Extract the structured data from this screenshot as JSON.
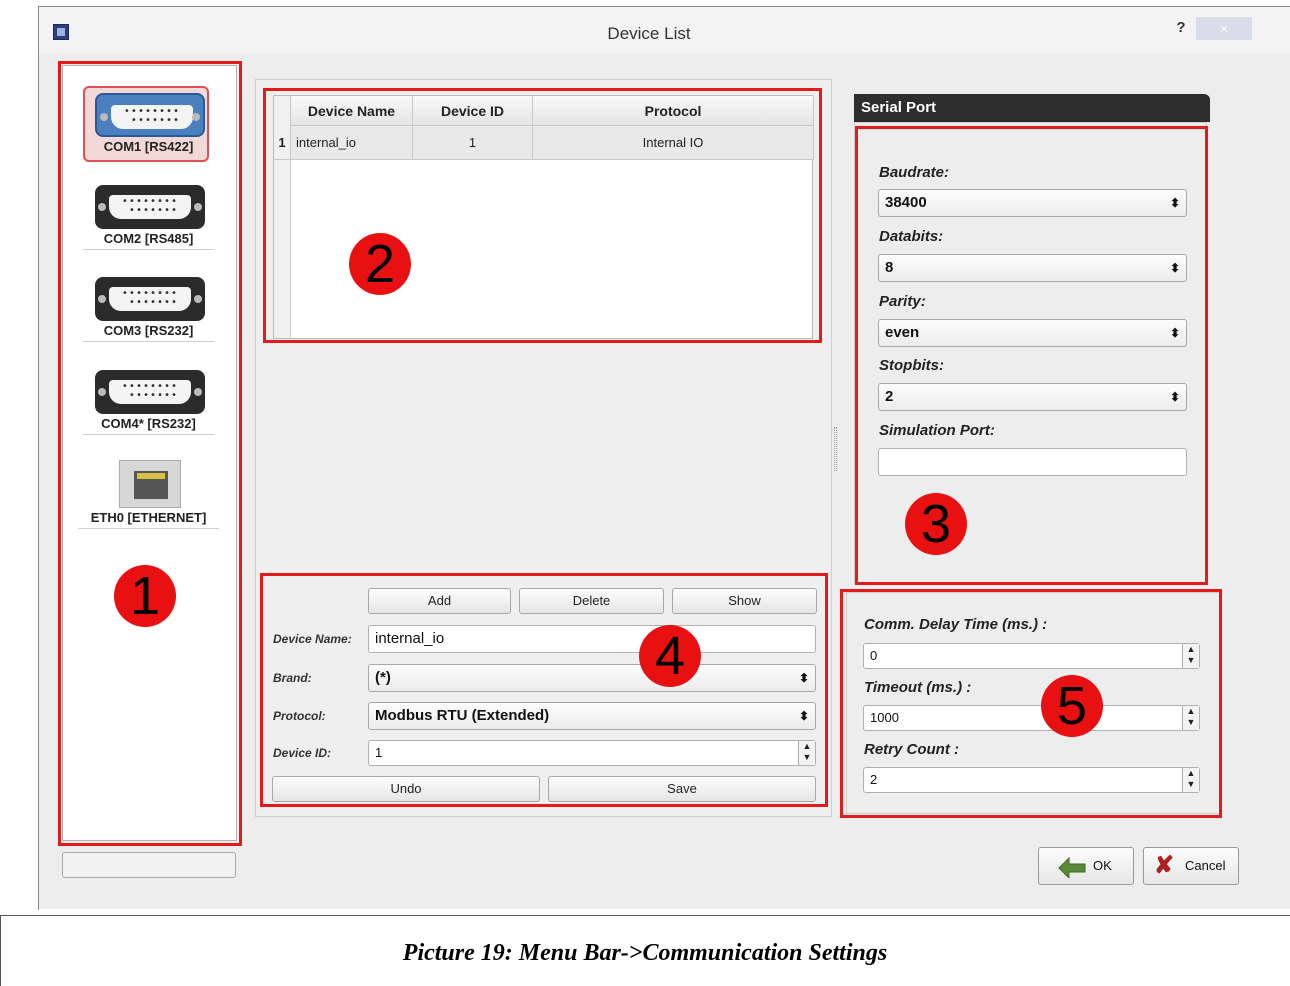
{
  "window": {
    "title": "Device List",
    "help_label": "?",
    "close_label": "×"
  },
  "ports": [
    {
      "label": "COM1 [RS422]",
      "icon": "serial-port-icon",
      "selected": true
    },
    {
      "label": "COM2 [RS485]",
      "icon": "serial-port-icon",
      "selected": false
    },
    {
      "label": "COM3 [RS232]",
      "icon": "serial-port-icon",
      "selected": false
    },
    {
      "label": "COM4* [RS232]",
      "icon": "serial-port-icon",
      "selected": false
    },
    {
      "label": "ETH0 [ETHERNET]",
      "icon": "ethernet-port-icon",
      "selected": false
    }
  ],
  "device_table": {
    "columns": [
      "Device Name",
      "Device ID",
      "Protocol"
    ],
    "rows": [
      {
        "index": "1",
        "name": "internal_io",
        "id": "1",
        "protocol": "Internal IO"
      }
    ]
  },
  "editor": {
    "add_label": "Add",
    "delete_label": "Delete",
    "show_label": "Show",
    "device_name_label": "Device Name:",
    "device_name_value": "internal_io",
    "brand_label": "Brand:",
    "brand_value": "(*)",
    "protocol_label": "Protocol:",
    "protocol_value": "Modbus RTU (Extended)",
    "device_id_label": "Device ID:",
    "device_id_value": "1",
    "undo_label": "Undo",
    "save_label": "Save"
  },
  "serial_port": {
    "header": "Serial Port",
    "baudrate_label": "Baudrate:",
    "baudrate_value": "38400",
    "databits_label": "Databits:",
    "databits_value": "8",
    "parity_label": "Parity:",
    "parity_value": "even",
    "stopbits_label": "Stopbits:",
    "stopbits_value": "2",
    "simulation_label": "Simulation Port:",
    "simulation_value": ""
  },
  "comm": {
    "delay_label": "Comm. Delay Time (ms.) :",
    "delay_value": "0",
    "timeout_label": "Timeout (ms.) :",
    "timeout_value": "1000",
    "retry_label": "Retry Count :",
    "retry_value": "2"
  },
  "footer": {
    "ok_label": "OK",
    "cancel_label": "Cancel"
  },
  "annotations": [
    "1",
    "2",
    "3",
    "4",
    "5"
  ],
  "annotation_color": "#e81010",
  "caption": "Picture 19: Menu Bar->Communication Settings"
}
